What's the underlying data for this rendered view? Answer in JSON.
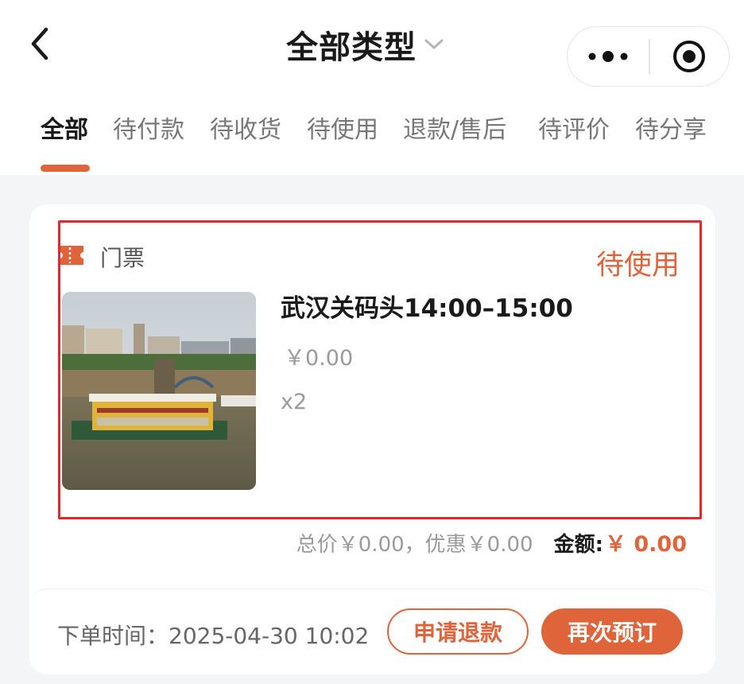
{
  "header": {
    "title": "全部类型",
    "back_icon": "chevron-left-icon",
    "dropdown_icon": "chevron-down-icon",
    "more_icon": "more-dots-icon",
    "close_icon": "target-close-icon"
  },
  "tabs": [
    {
      "label": "全部",
      "active": true
    },
    {
      "label": "待付款",
      "active": false
    },
    {
      "label": "待收货",
      "active": false
    },
    {
      "label": "待使用",
      "active": false
    },
    {
      "label": "退款/售后",
      "active": false
    },
    {
      "label": "待评价",
      "active": false
    },
    {
      "label": "待分享",
      "active": false
    }
  ],
  "order": {
    "category": "门票",
    "category_icon": "ticket-icon",
    "status": "待使用",
    "item_title": "武汉关码头14:00–15:00",
    "item_price": "￥0.00",
    "item_qty": "x2",
    "total_text": "总价￥0.00，优惠￥0.00",
    "amount_label": "金额:",
    "amount_value": "￥ 0.00",
    "order_time": "下单时间：2025-04-30 10:02",
    "refund_button": "申请退款",
    "rebook_button": "再次预订"
  },
  "colors": {
    "accent": "#e0643a",
    "highlight": "#e6262a",
    "page_bg": "#f4f5f7"
  }
}
